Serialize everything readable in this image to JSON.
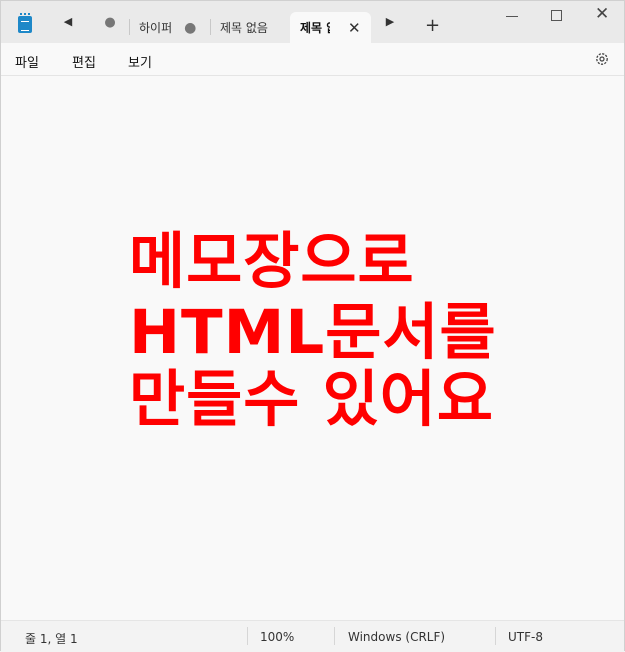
{
  "tabs": [
    {
      "label": "하이퍼",
      "unsaved_marker": "●"
    },
    {
      "label": "제목 없음"
    },
    {
      "label": "제목 없음",
      "close": "✕"
    }
  ],
  "titlebar": {
    "prev_tab": "◀",
    "first_tab_marker": "●",
    "next_tab": "▶",
    "new_tab": "+",
    "close_window": "✕"
  },
  "menu": {
    "file": "파일",
    "edit": "편집",
    "view": "보기"
  },
  "document": {
    "lines": [
      "메모장으로",
      "HTML문서를",
      "만들수 있어요"
    ],
    "text_color": "#ff0000"
  },
  "status": {
    "position": "줄 1, 열 1",
    "zoom": "100%",
    "line_ending": "Windows (CRLF)",
    "encoding": "UTF-8"
  },
  "icons": {
    "app": "notepad-icon",
    "settings": "gear-icon"
  }
}
